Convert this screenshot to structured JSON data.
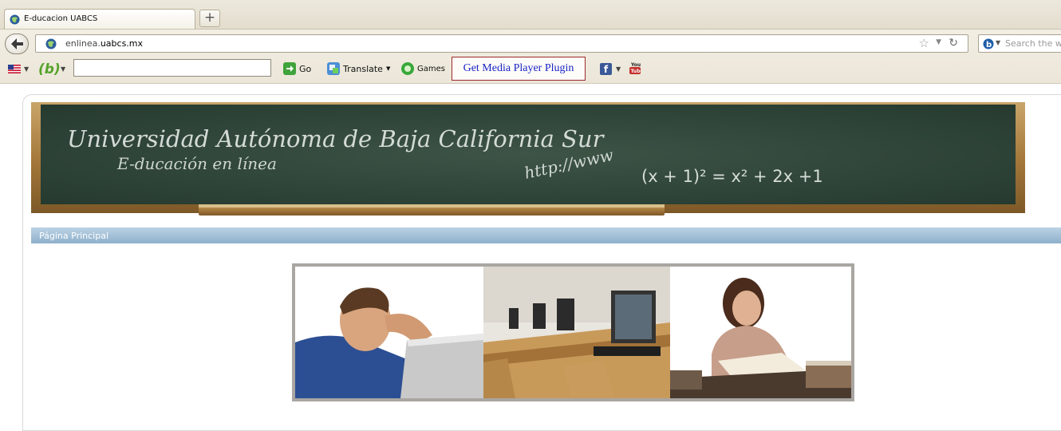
{
  "browser": {
    "tab_title": "E-ducacion UABCS",
    "new_tab_label": "+",
    "url_host": "enlinea.",
    "url_domain": "uabcs.mx",
    "search_placeholder": "Search the web",
    "toolbar": {
      "go_label": "Go",
      "translate_label": "Translate",
      "games_label": "Games",
      "plugin_label": "Get Media Player Plugin",
      "facebook_letter": "f",
      "youtube_label": "You Tube"
    }
  },
  "banner": {
    "title": "Universidad Autónoma de Baja California Sur",
    "subtitle": "E-ducación en línea",
    "http_text": "http://www",
    "equation": "(x + 1)² = x² + 2x +1"
  },
  "nav": {
    "current_page": "Página Principal"
  },
  "colors": {
    "chalkboard": "#2f4438",
    "nav_strip": "#9dbad2",
    "plugin_text": "#1a24c8"
  }
}
